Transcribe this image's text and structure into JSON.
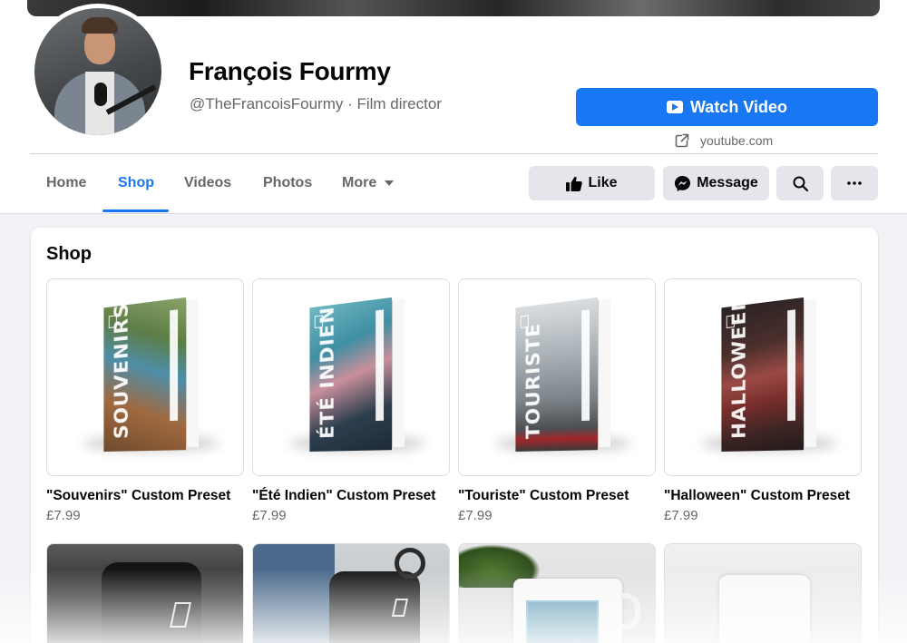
{
  "profile": {
    "name": "François Fourmy",
    "subtitle": "@TheFrancoisFourmy · Film director",
    "cta_label": "Watch Video",
    "cta_link": "youtube.com"
  },
  "tabs": [
    {
      "label": "Home",
      "active": false
    },
    {
      "label": "Shop",
      "active": true
    },
    {
      "label": "Videos",
      "active": false
    },
    {
      "label": "Photos",
      "active": false
    },
    {
      "label": "More",
      "active": false
    }
  ],
  "actions": {
    "like_label": "Like",
    "message_label": "Message",
    "search_icon": "search-icon",
    "more_icon": "more-horizontal-icon"
  },
  "shop": {
    "title": "Shop",
    "products": [
      {
        "title": "\"Souvenirs\" Custom Preset",
        "price": "£7.99",
        "box_word": "SOUVENIRS"
      },
      {
        "title": "\"Été Indien\" Custom Preset",
        "price": "£7.99",
        "box_word": "ÉTÉ INDIEN"
      },
      {
        "title": "\"Touriste\" Custom Preset",
        "price": "£7.99",
        "box_word": "TOURISTE"
      },
      {
        "title": "\"Halloween\" Custom Preset",
        "price": "£7.99",
        "box_word": "HALLOWEEN"
      }
    ]
  },
  "colors": {
    "accent": "#1877f2",
    "background": "#f0f2f5",
    "secondary_text": "#65676b"
  }
}
